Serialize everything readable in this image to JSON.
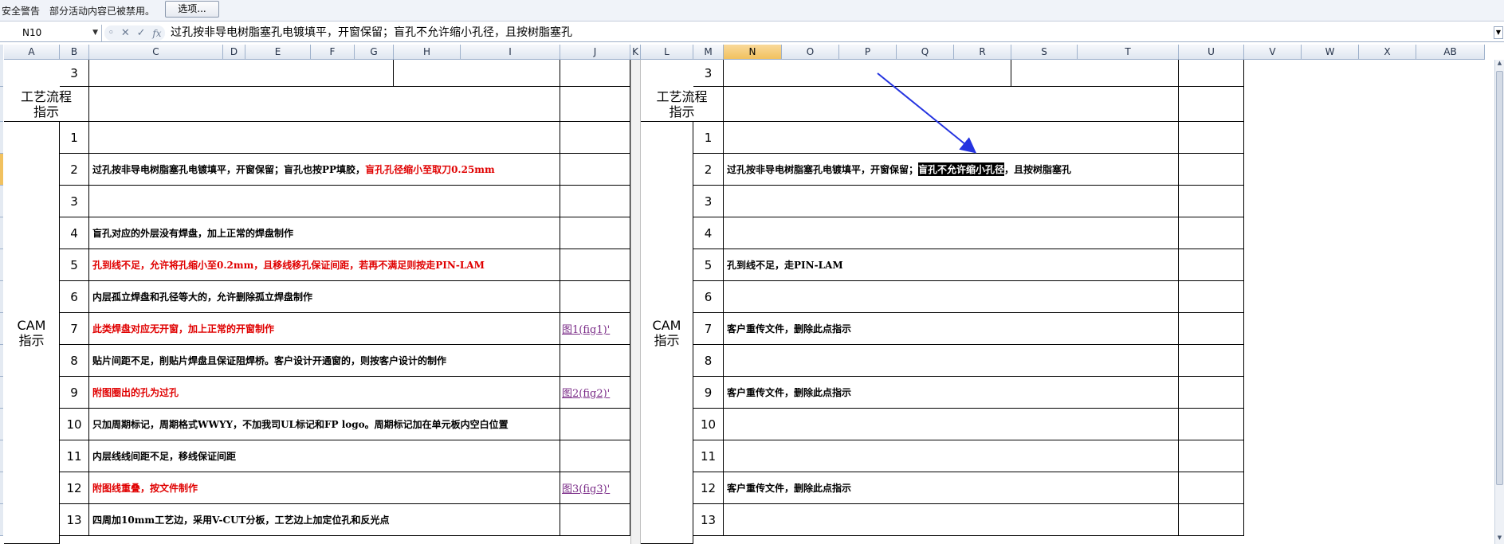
{
  "security_bar": {
    "warning_label": "安全警告",
    "message": "部分活动内容已被禁用。",
    "options_button": "选项..."
  },
  "formula_bar": {
    "name_box": "N10",
    "content": "过孔按非导电树脂塞孔电镀填平，开窗保留；盲孔不允许缩小孔径，且按树脂塞孔"
  },
  "columns": [
    "A",
    "B",
    "C",
    "D",
    "E",
    "F",
    "G",
    "H",
    "I",
    "J",
    "K",
    "L",
    "M",
    "N",
    "O",
    "P",
    "Q",
    "R",
    "S",
    "T",
    "U",
    "V",
    "W",
    "X",
    "AB"
  ],
  "selected_column": "N",
  "left_panel": {
    "top_row_number": "3",
    "process_label": "工艺流程\n指示",
    "cam_label": "CAM\n指示",
    "rows": [
      {
        "num": "1",
        "text": "",
        "red": false,
        "link": ""
      },
      {
        "num": "2",
        "text": "过孔按非导电树脂塞孔电镀填平，开窗保留；盲孔也按PP填胶，",
        "text_red": "盲孔孔径缩小至取刀0.25mm",
        "red": false,
        "link": ""
      },
      {
        "num": "3",
        "text": "",
        "red": false,
        "link": ""
      },
      {
        "num": "4",
        "text": "盲孔对应的外层没有焊盘，加上正常的焊盘制作",
        "red": false,
        "link": ""
      },
      {
        "num": "5",
        "text": "孔到线不足，允许将孔缩小至0.2mm，且移线移孔保证间距，若再不满足则按走PIN-LAM",
        "red": true,
        "link": ""
      },
      {
        "num": "6",
        "text": "内层孤立焊盘和孔径等大的，允许删除孤立焊盘制作",
        "red": false,
        "link": ""
      },
      {
        "num": "7",
        "text": "此类焊盘对应无开窗，加上正常的开窗制作",
        "red": true,
        "link": "图1(fig1)'"
      },
      {
        "num": "8",
        "text": "贴片间距不足，削贴片焊盘且保证阻焊桥。客户设计开通窗的，则按客户设计的制作",
        "red": false,
        "link": ""
      },
      {
        "num": "9",
        "text": "附图圈出的孔为过孔",
        "red": true,
        "link": "图2(fig2)'"
      },
      {
        "num": "10",
        "text": "只加周期标记，周期格式WWYY，不加我司UL标记和FP logo。周期标记加在单元板内空白位置",
        "red": false,
        "link": ""
      },
      {
        "num": "11",
        "text": "内层线线间距不足，移线保证间距",
        "red": false,
        "link": ""
      },
      {
        "num": "12",
        "text": "附图线重叠，按文件制作",
        "red": true,
        "link": "图3(fig3)'"
      },
      {
        "num": "13",
        "text": "四周加10mm工艺边，采用V-CUT分板，工艺边上加定位孔和反光点",
        "red": false,
        "link": ""
      }
    ]
  },
  "right_panel": {
    "top_row_number": "3",
    "process_label": "工艺流程\n指示",
    "cam_label": "CAM\n指示",
    "rows": [
      {
        "num": "1",
        "text": ""
      },
      {
        "num": "2",
        "text": "过孔按非导电树脂塞孔电镀填平，开窗保留；",
        "text_hl": "盲孔不允许缩小孔径",
        "text_after": "，且按树脂塞孔"
      },
      {
        "num": "3",
        "text": ""
      },
      {
        "num": "4",
        "text": ""
      },
      {
        "num": "5",
        "text": "孔到线不足，走PIN-LAM"
      },
      {
        "num": "6",
        "text": ""
      },
      {
        "num": "7",
        "text": "客户重传文件，删除此点指示"
      },
      {
        "num": "8",
        "text": ""
      },
      {
        "num": "9",
        "text": "客户重传文件，删除此点指示"
      },
      {
        "num": "10",
        "text": ""
      },
      {
        "num": "11",
        "text": ""
      },
      {
        "num": "12",
        "text": "客户重传文件，删除此点指示"
      },
      {
        "num": "13",
        "text": ""
      }
    ]
  },
  "colors": {
    "red_text": "#e00000",
    "link_text": "#7a2b87",
    "arrow": "#2433e0",
    "selected_header": "#f1c15f"
  }
}
